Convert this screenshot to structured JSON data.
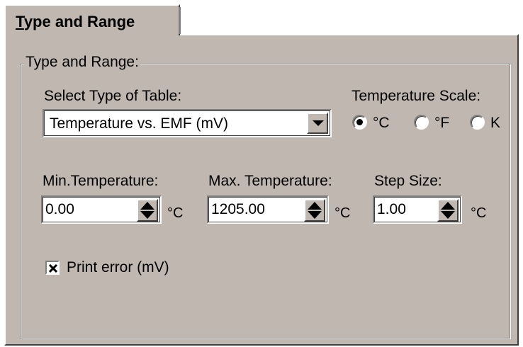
{
  "tab": {
    "label_underlined": "T",
    "label_rest": "ype and Range"
  },
  "group": {
    "title": "Type and Range:"
  },
  "table_type": {
    "label": "Select Type of Table:",
    "selected": "Temperature vs. EMF (mV)"
  },
  "scale": {
    "label": "Temperature Scale:",
    "options": [
      {
        "label": "°C",
        "selected": true
      },
      {
        "label": "°F",
        "selected": false
      },
      {
        "label": "K",
        "selected": false
      }
    ]
  },
  "min_temp": {
    "label": "Min.Temperature:",
    "value": "0.00",
    "unit": "°C"
  },
  "max_temp": {
    "label": "Max. Temperature:",
    "value": "1205.00",
    "unit": "°C"
  },
  "step": {
    "label": "Step Size:",
    "value": "1.00",
    "unit": "°C"
  },
  "print_error": {
    "label": "Print error (mV)",
    "checked": true
  }
}
